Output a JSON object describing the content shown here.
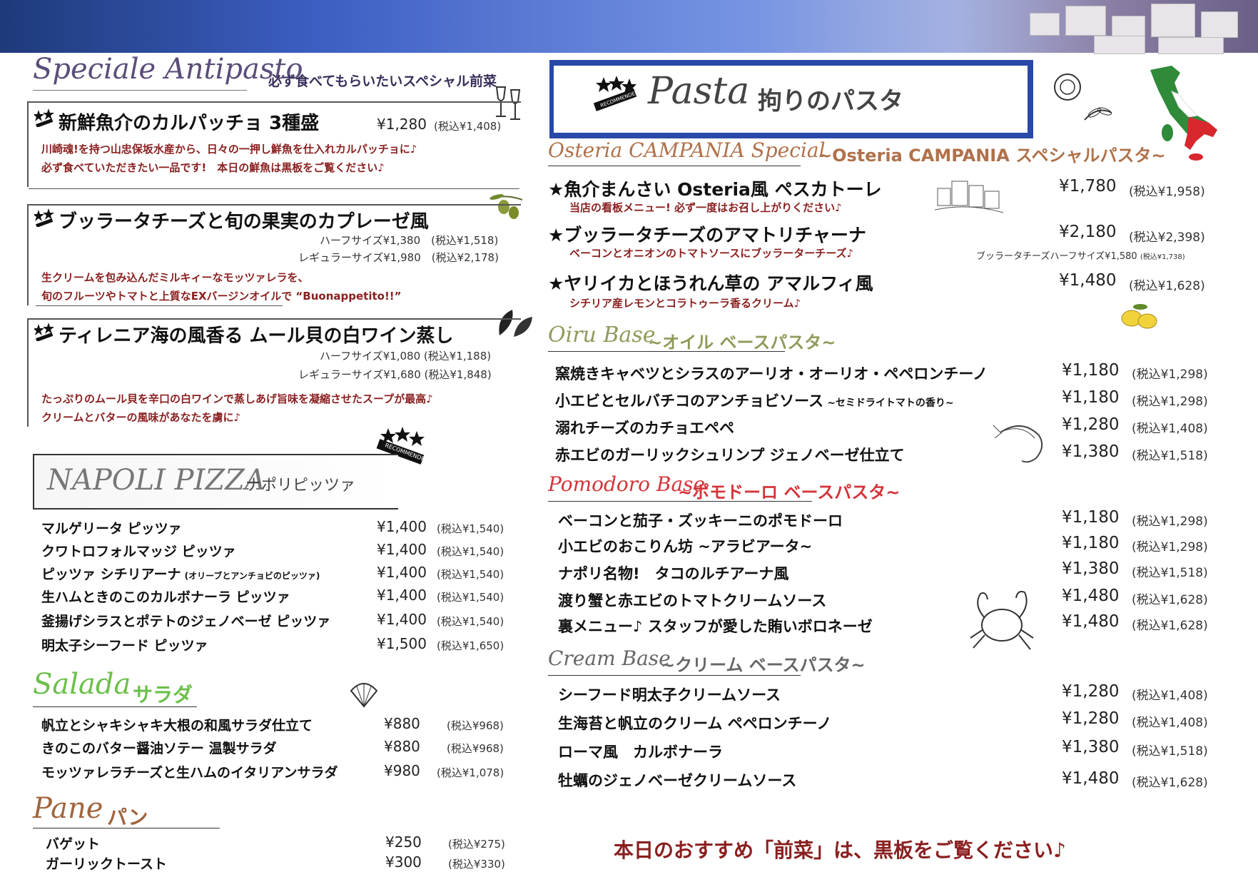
{
  "antipasto": {
    "title_script": "Speciale Antipasto",
    "title_jp": "必ず食べてもらいたいスペシャル前菜",
    "items": [
      {
        "name": "新鮮魚介のカルパッチョ 3種盛",
        "price": "¥1,280",
        "tax": "(税込¥1,408)",
        "desc1": "川崎魂!を持つ山忠保坂水産から、日々の一押し鮮魚を仕入れカルパッチョに♪",
        "desc2": "必ず食べていただきたい一品です!　本日の鮮魚は黒板をご覧ください♪"
      },
      {
        "name": "ブッラータチーズと旬の果実のカプレーゼ風",
        "half": "ハーフサイズ¥1,380　(税込¥1,518)",
        "regular": "レギュラーサイズ¥1,980　(税込¥2,178)",
        "desc1": "生クリームを包み込んだミルキィーなモッツァレラを、",
        "desc2": "旬のフルーツやトマトと上質なEXバージンオイルで “Buonappetito!!”"
      },
      {
        "name": "ティレニア海の風香る ムール貝の白ワイン蒸し",
        "half": "ハーフサイズ¥1,080 (税込¥1,188)",
        "regular": "レギュラーサイズ¥1,680 (税込¥1,848)",
        "desc1": "たっぷりのムール貝を辛口の白ワインで蒸しあげ旨味を凝縮させたスープが最高♪",
        "desc2": "クリームとバターの風味があなたを虜に♪"
      }
    ]
  },
  "pizza": {
    "title_script": "NAPOLI PIZZA",
    "title_jp": "ナポリピッツァ",
    "badge": "RECOMMENDED",
    "items": [
      {
        "name": "マルゲリータ ピッツァ",
        "note": "",
        "price": "¥1,400",
        "tax": "(税込¥1,540)"
      },
      {
        "name": "クワトロフォルマッジ ピッツァ",
        "note": "",
        "price": "¥1,400",
        "tax": "(税込¥1,540)"
      },
      {
        "name": "ピッツァ シチリアーナ",
        "note": "(オリーブとアンチョビのピッツァ)",
        "price": "¥1,400",
        "tax": "(税込¥1,540)"
      },
      {
        "name": "生ハムときのこのカルボナーラ ピッツァ",
        "note": "",
        "price": "¥1,400",
        "tax": "(税込¥1,540)"
      },
      {
        "name": "釜揚げシラスとポテトのジェノベーゼ ピッツァ",
        "note": "",
        "price": "¥1,400",
        "tax": "(税込¥1,540)"
      },
      {
        "name": "明太子シーフード ピッツァ",
        "note": "",
        "price": "¥1,500",
        "tax": "(税込¥1,650)"
      }
    ]
  },
  "salada": {
    "title_script": "Salada",
    "title_jp": "サラダ",
    "items": [
      {
        "name": "帆立とシャキシャキ大根の和風サラダ仕立て",
        "price": "¥880",
        "tax": "(税込¥968)"
      },
      {
        "name": "きのこのバター醤油ソテー 温製サラダ",
        "price": "¥880",
        "tax": "(税込¥968)"
      },
      {
        "name": "モッツァレラチーズと生ハムのイタリアンサラダ",
        "price": "¥980",
        "tax": "(税込¥1,078)"
      }
    ]
  },
  "pane": {
    "title_script": "Pane",
    "title_jp": "パン",
    "items": [
      {
        "name": "バゲット",
        "price": "¥250",
        "tax": "(税込¥275)"
      },
      {
        "name": "ガーリックトースト",
        "price": "¥300",
        "tax": "(税込¥330)"
      }
    ]
  },
  "pasta": {
    "title_script": "Pasta",
    "title_jp": "拘りのパスタ",
    "badge": "RECOMMENDED",
    "special": {
      "title_script": "Osteria CAMPANIA Special",
      "title_jp": "~Osteria CAMPANIA スペシャルパスタ~",
      "items": [
        {
          "name": "★魚介まんさい Osteria風 ペスカトーレ",
          "price": "¥1,780",
          "tax": "(税込¥1,958)",
          "desc": "当店の看板メニュー! 必ず一度はお召し上がりください♪"
        },
        {
          "name": "★ブッラータチーズのアマトリチャーナ",
          "price": "¥2,180",
          "tax": "(税込¥2,398)",
          "desc": "ベーコンとオニオンのトマトソースにブッラーターチーズ♪",
          "extra": "ブッラータチーズハーフサイズ¥1,580",
          "extra_tax": "(税込¥1,738)"
        },
        {
          "name": "★ヤリイカとほうれん草の アマルフィ風",
          "price": "¥1,480",
          "tax": "(税込¥1,628)",
          "desc": "シチリア産レモンとコラトゥーラ香るクリーム♪"
        }
      ]
    },
    "oil": {
      "title_script": "Oiru Base",
      "title_jp": "~オイル ベースパスタ~",
      "items": [
        {
          "name": "窯焼きキャベツとシラスのアーリオ・オーリオ・ペペロンチーノ",
          "note": "",
          "price": "¥1,180",
          "tax": "(税込¥1,298)"
        },
        {
          "name": "小エビとセルバチコのアンチョビソース",
          "note": "~セミドライトマトの香り~",
          "price": "¥1,180",
          "tax": "(税込¥1,298)"
        },
        {
          "name": "溺れチーズのカチョエペペ",
          "note": "",
          "price": "¥1,280",
          "tax": "(税込¥1,408)"
        },
        {
          "name": "赤エビのガーリックシュリンプ ジェノベーゼ仕立て",
          "note": "",
          "price": "¥1,380",
          "tax": "(税込¥1,518)"
        }
      ]
    },
    "pomodoro": {
      "title_script": "Pomodoro Base",
      "title_jp": "~ポモドーロ ベースパスタ~",
      "items": [
        {
          "name": "ベーコンと茄子・ズッキーニのポモドーロ",
          "price": "¥1,180",
          "tax": "(税込¥1,298)"
        },
        {
          "name": "小エビのおこりん坊 ~アラビアータ~",
          "price": "¥1,180",
          "tax": "(税込¥1,298)"
        },
        {
          "name": "ナポリ名物!　タコのルチアーナ風",
          "price": "¥1,380",
          "tax": "(税込¥1,518)"
        },
        {
          "name": "渡り蟹と赤エビのトマトクリームソース",
          "price": "¥1,480",
          "tax": "(税込¥1,628)"
        },
        {
          "name": "裏メニュー♪ スタッフが愛した賄いボロネーゼ",
          "price": "¥1,480",
          "tax": "(税込¥1,628)"
        }
      ]
    },
    "cream": {
      "title_script": "Cream Base",
      "title_jp": "~クリーム ベースパスタ~",
      "items": [
        {
          "name": "シーフード明太子クリームソース",
          "price": "¥1,280",
          "tax": "(税込¥1,408)"
        },
        {
          "name": "生海苔と帆立のクリーム ペペロンチーノ",
          "price": "¥1,280",
          "tax": "(税込¥1,408)"
        },
        {
          "name": "ローマ風　カルボナーラ",
          "price": "¥1,380",
          "tax": "(税込¥1,518)"
        },
        {
          "name": "牡蠣のジェノベーゼクリームソース",
          "price": "¥1,480",
          "tax": "(税込¥1,628)"
        }
      ]
    }
  },
  "footer_note": "本日のおすすめ「前菜」は、黒板をご覧ください♪",
  "colors": {
    "antipasto": "#5b4d7a",
    "special": "#b0714a",
    "oil": "#8f9a5a",
    "pomodoro": "#d3353a",
    "cream": "#666666",
    "salada": "#6cc04a",
    "pane": "#a0653e",
    "desc": "#8a1f1f",
    "footer": "#8a1f1f"
  }
}
